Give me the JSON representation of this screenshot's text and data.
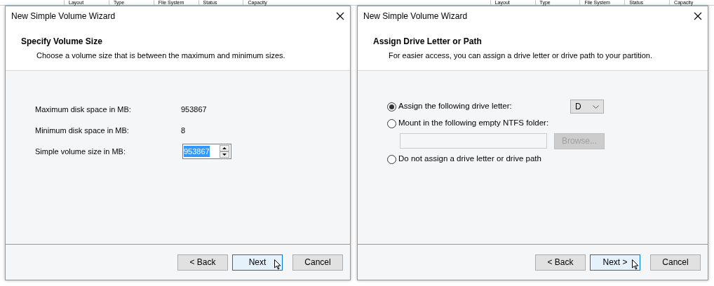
{
  "background_tables": [
    {
      "columns": [
        "Layout",
        "Type",
        "File System",
        "Status",
        "Capacity"
      ]
    },
    {
      "columns": [
        "Layout",
        "Type",
        "File System",
        "Status",
        "Capacity"
      ]
    }
  ],
  "dialogs": [
    {
      "kind": "size",
      "title": "New Simple Volume Wizard",
      "heading": "Specify Volume Size",
      "subheading": "Choose a volume size that is between the maximum and minimum sizes.",
      "rows": [
        {
          "label": "Maximum disk space in MB:",
          "value": "953867"
        },
        {
          "label": "Minimum disk space in MB:",
          "value": "8"
        }
      ],
      "spin": {
        "label": "Simple volume size in MB:",
        "value": "953867",
        "selected": true
      },
      "buttons": [
        {
          "label": "< Back",
          "hovered": false
        },
        {
          "label": "Next",
          "hovered": true
        },
        {
          "label": "Cancel",
          "hovered": false
        }
      ]
    },
    {
      "kind": "drive",
      "title": "New Simple Volume Wizard",
      "heading": "Assign Drive Letter or Path",
      "subheading": "For easier access, you can assign a drive letter or drive path to your partition.",
      "options": [
        {
          "kind": "letter",
          "label": "Assign the following drive letter:",
          "selected": true,
          "value": "D"
        },
        {
          "kind": "folder",
          "label": "Mount in the following empty NTFS folder:",
          "selected": false,
          "button": "Browse...",
          "disabled": true
        },
        {
          "kind": "plain",
          "label": "Do not assign a drive letter or drive path",
          "selected": false
        }
      ],
      "buttons": [
        {
          "label": "< Back",
          "hovered": false
        },
        {
          "label": "Next >",
          "hovered": true
        },
        {
          "label": "Cancel",
          "hovered": false
        }
      ]
    }
  ]
}
